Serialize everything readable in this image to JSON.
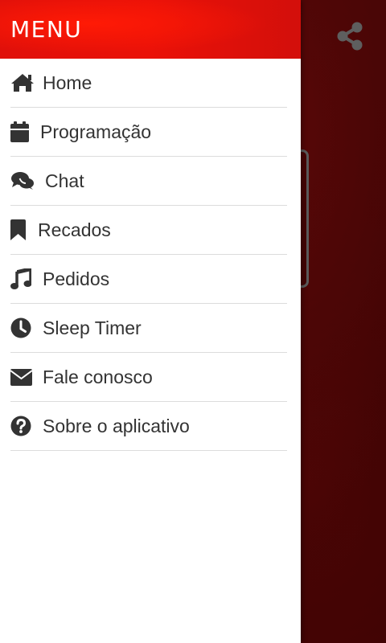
{
  "drawer": {
    "title": "MENU",
    "items": [
      {
        "label": "Home",
        "icon": "home-icon"
      },
      {
        "label": "Programação",
        "icon": "calendar-icon"
      },
      {
        "label": "Chat",
        "icon": "chat-icon"
      },
      {
        "label": "Recados",
        "icon": "bookmark-icon"
      },
      {
        "label": "Pedidos",
        "icon": "music-note-icon"
      },
      {
        "label": "Sleep Timer",
        "icon": "clock-icon"
      },
      {
        "label": "Fale conosco",
        "icon": "envelope-icon"
      },
      {
        "label": "Sobre o aplicativo",
        "icon": "question-circle-icon"
      }
    ]
  },
  "background_app": {
    "share_icon": "share-icon"
  },
  "colors": {
    "header_red": "#e8100a",
    "background_dark_red": "#3a0303",
    "text": "#333333",
    "divider": "#dcdcdc"
  }
}
